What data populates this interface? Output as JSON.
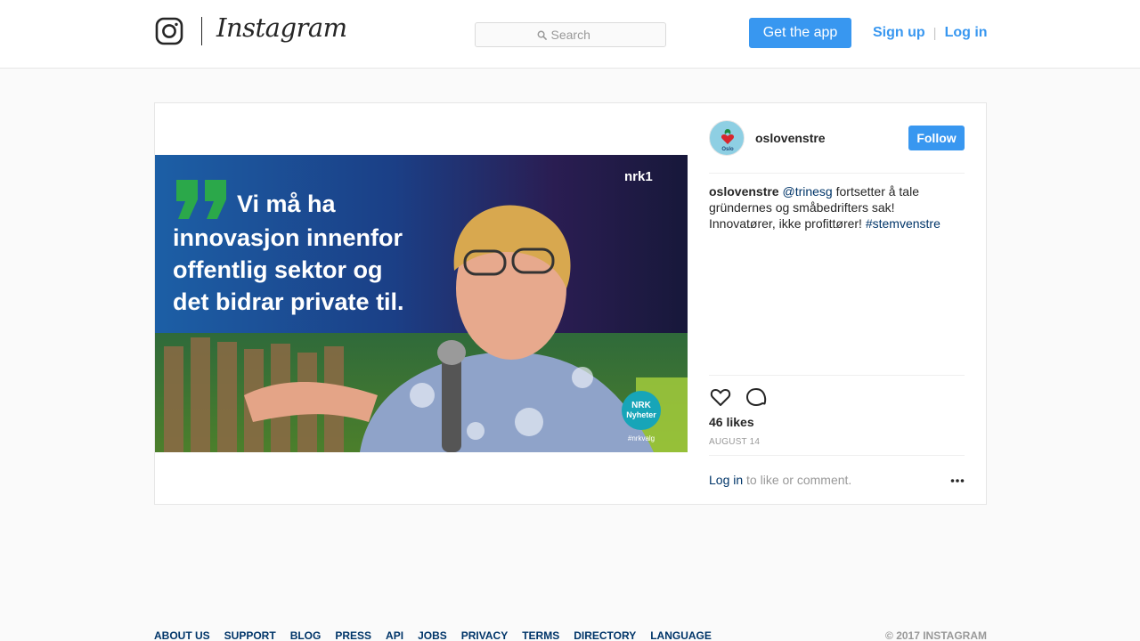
{
  "header": {
    "brand": "Instagram",
    "search_placeholder": "Search",
    "get_app_label": "Get the app",
    "signup_label": "Sign up",
    "separator": "|",
    "login_label": "Log in"
  },
  "post": {
    "image_text": {
      "quote_lines": [
        "Vi må ha",
        "innovasjon innenfor",
        "offentlig sektor og",
        "det bidrar private til."
      ],
      "channel_logo": "nrk1",
      "badge_line1": "NRK",
      "badge_line2": "Nyheter",
      "tag": "#nrkvalg"
    },
    "avatar_label": "Oslo",
    "username": "oslovenstre",
    "follow_label": "Follow",
    "caption": {
      "user": "oslovenstre",
      "mention": "@trinesg",
      "text1": " fortsetter å tale gründernes og småbedrifters sak! Innovatører, ikke profittører! ",
      "hashtag": "#stemvenstre"
    },
    "likes": "46 likes",
    "date": "AUGUST 14",
    "login_prompt_link": "Log in",
    "login_prompt_text": " to like or comment.",
    "icons": [
      "heart-icon",
      "comment-icon",
      "more-icon"
    ]
  },
  "footer": {
    "links": [
      "ABOUT US",
      "SUPPORT",
      "BLOG",
      "PRESS",
      "API",
      "JOBS",
      "PRIVACY",
      "TERMS",
      "DIRECTORY",
      "LANGUAGE"
    ],
    "copyright": "© 2017 INSTAGRAM"
  },
  "colors": {
    "accent": "#3897f0",
    "link_dark": "#003569",
    "muted": "#999999",
    "quote_green": "#2ba84a"
  }
}
